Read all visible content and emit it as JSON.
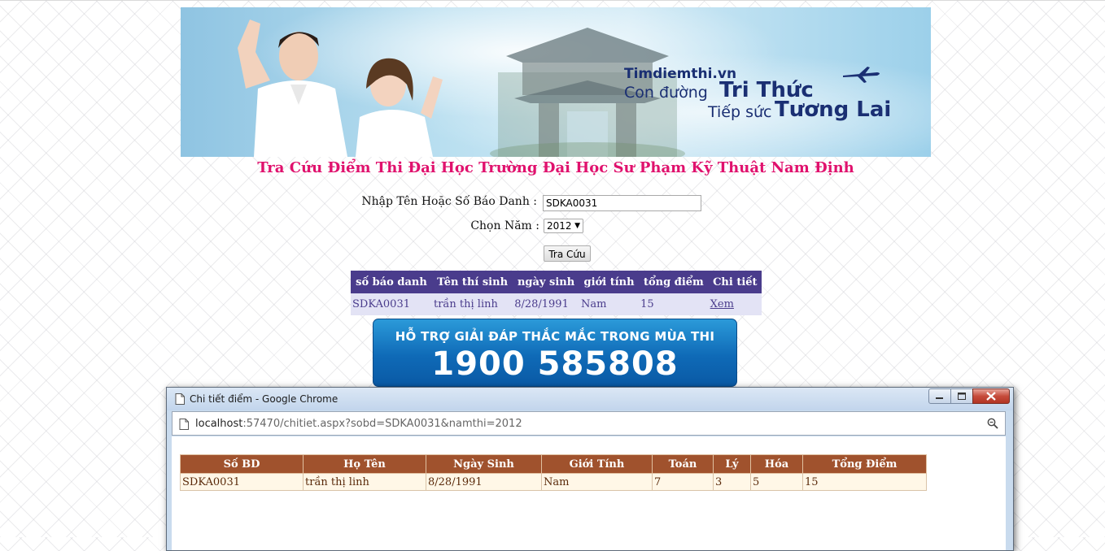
{
  "banner": {
    "site": "Timdiemthi.vn",
    "line1_a": "Con đường",
    "line1_b": "Tri Thức",
    "line2_a": "Tiếp sức",
    "line2_b": "Tương Lai"
  },
  "page": {
    "title": "Tra Cứu Điểm Thi Đại Học Trường Đại Học Sư Phạm Kỹ Thuật Nam Định"
  },
  "form": {
    "name_label": "Nhập Tên Hoặc Số Báo Danh :",
    "name_value": "SDKA0031",
    "year_label": "Chọn Năm :",
    "year_value": "2012",
    "search_button": "Tra Cứu"
  },
  "results": {
    "headers": [
      "số báo danh",
      "Tên thí sinh",
      "ngày sinh",
      "giới tính",
      "tổng điểm",
      "Chi tiết"
    ],
    "rows": [
      [
        "SDKA0031",
        "trần thị linh",
        "8/28/1991",
        "Nam",
        "15",
        "Xem"
      ]
    ]
  },
  "hotline": {
    "caption": "HỖ TRỢ GIẢI ĐÁP THẮC MẮC TRONG MÙA THI",
    "number": "1900 585808"
  },
  "popup": {
    "window_title": "Chi tiết điểm - Google Chrome",
    "url_host": "localhost",
    "url_rest": ":57470/chitiet.aspx?sobd=SDKA0031&namthi=2012",
    "detail_headers": [
      "Số BD",
      "Họ Tên",
      "Ngày Sinh",
      "Giới Tính",
      "Toán",
      "Lý",
      "Hóa",
      "Tổng Điểm"
    ],
    "detail_rows": [
      [
        "SDKA0031",
        "trần thị linh",
        "8/28/1991",
        "Nam",
        "7",
        "3",
        "5",
        "15"
      ]
    ]
  }
}
